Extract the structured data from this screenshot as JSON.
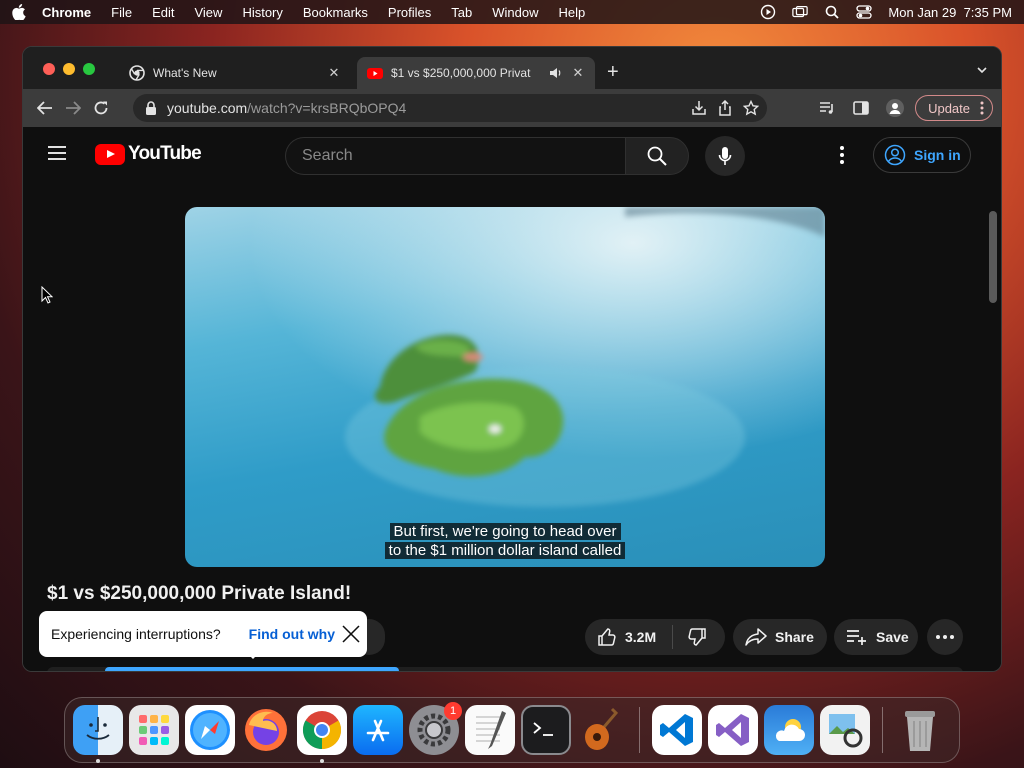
{
  "menubar": {
    "app": "Chrome",
    "items": [
      "File",
      "Edit",
      "View",
      "History",
      "Bookmarks",
      "Profiles",
      "Tab",
      "Window",
      "Help"
    ],
    "datetime": "Mon Jan 29  7:35 PM"
  },
  "browser": {
    "tabs": [
      {
        "title": "What's New",
        "icon": "chrome-icon"
      },
      {
        "title": "$1 vs $250,000,000 Privat",
        "icon": "youtube-icon",
        "audio": "speaker-icon"
      }
    ],
    "url_host": "youtube.com",
    "url_path": "/watch?v=krsBRQbOPQ4",
    "update_label": "Update"
  },
  "youtube": {
    "logo_text": "YouTube",
    "search_placeholder": "Search",
    "signin_label": "Sign in",
    "caption_line1": "But first, we're going to head over",
    "caption_line2": "to the $1 million dollar island called",
    "video_title": "$1 vs $250,000,000 Private Island!",
    "like_count": "3.2M",
    "share_label": "Share",
    "save_label": "Save",
    "toast_text": "Experiencing interruptions?",
    "toast_link": "Find out why"
  },
  "dock": {
    "apps": [
      "Finder",
      "Launchpad",
      "Safari",
      "Firefox",
      "Chrome",
      "App Store",
      "System Settings",
      "TextEdit",
      "Terminal",
      "GarageBand",
      "Visual Studio Code",
      "Visual Studio",
      "Weather",
      "Preview",
      "Trash"
    ],
    "settings_badge": "1"
  },
  "colors": {
    "yt_red": "#ff0000",
    "link_blue": "#3ea6ff",
    "toast_link": "#065fd4"
  }
}
